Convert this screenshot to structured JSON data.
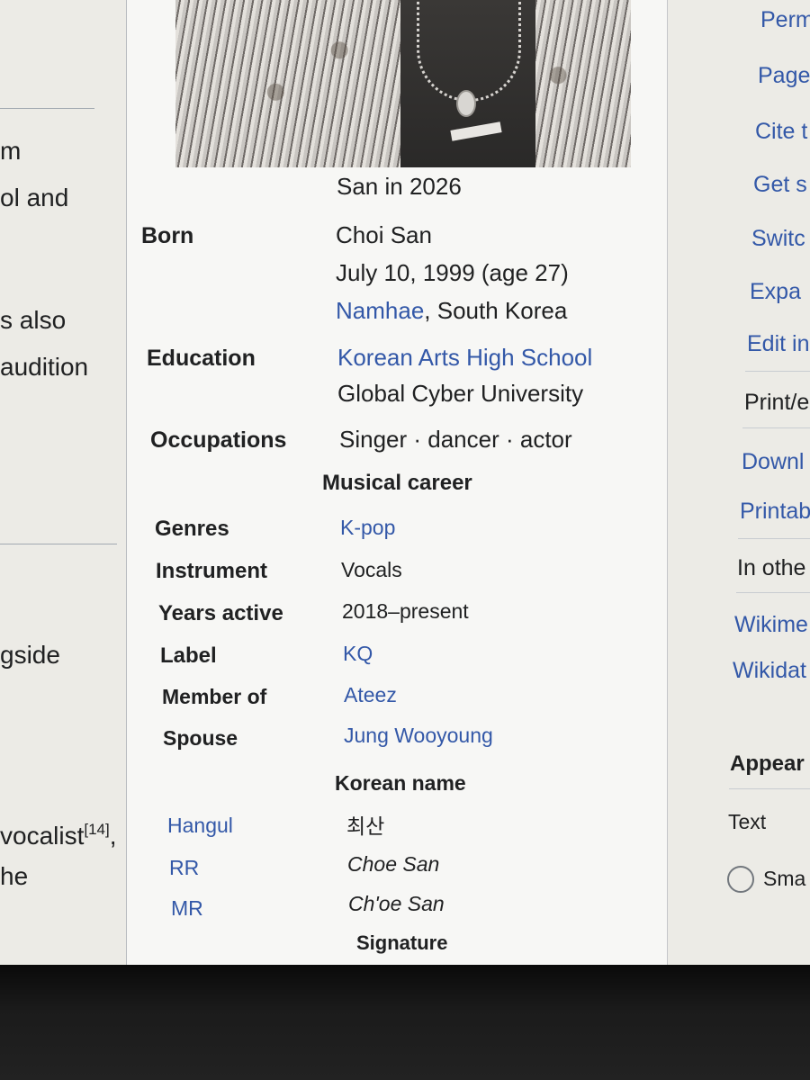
{
  "article": {
    "lines": [
      "m",
      "ol and",
      "s also",
      "audition",
      "gside",
      "vocalist",
      "he"
    ],
    "ref14": "[14]",
    "ref14_suffix": ","
  },
  "infobox": {
    "caption": "San in 2026",
    "born_label": "Born",
    "born_name": "Choi San",
    "born_date": "July 10, 1999 (age 27)",
    "born_place_link": "Namhae",
    "born_place_rest": ", South Korea",
    "education_label": "Education",
    "education_1": "Korean Arts High School",
    "education_2": "Global Cyber University",
    "occupations_label": "Occupations",
    "occupations_value": "Singer · dancer · actor",
    "musical_career_heading": "Musical career",
    "genres_label": "Genres",
    "genres_value": "K-pop",
    "instrument_label": "Instrument",
    "instrument_value": "Vocals",
    "years_label": "Years active",
    "years_value": "2018–present",
    "label_label": "Label",
    "label_value": "KQ",
    "member_label": "Member of",
    "member_value": "Ateez",
    "spouse_label": "Spouse",
    "spouse_value": "Jung Wooyoung",
    "korean_name_heading": "Korean name",
    "hangul_label": "Hangul",
    "hangul_value": "최산",
    "rr_label": "RR",
    "rr_value": "Choe San",
    "mr_label": "MR",
    "mr_value": "Ch'oe San",
    "signature_heading": "Signature"
  },
  "sidebar": {
    "tools": [
      "Perm",
      "Page",
      "Cite t",
      "Get s",
      "Switc",
      "Expa",
      "Edit in"
    ],
    "print_heading": "Print/e",
    "print_items": [
      "Downl",
      "Printab"
    ],
    "other_heading": "In othe",
    "other_items": [
      "Wikime",
      "Wikidat"
    ],
    "appearance_heading": "Appear",
    "text_label": "Text",
    "small_option": "Sma"
  }
}
